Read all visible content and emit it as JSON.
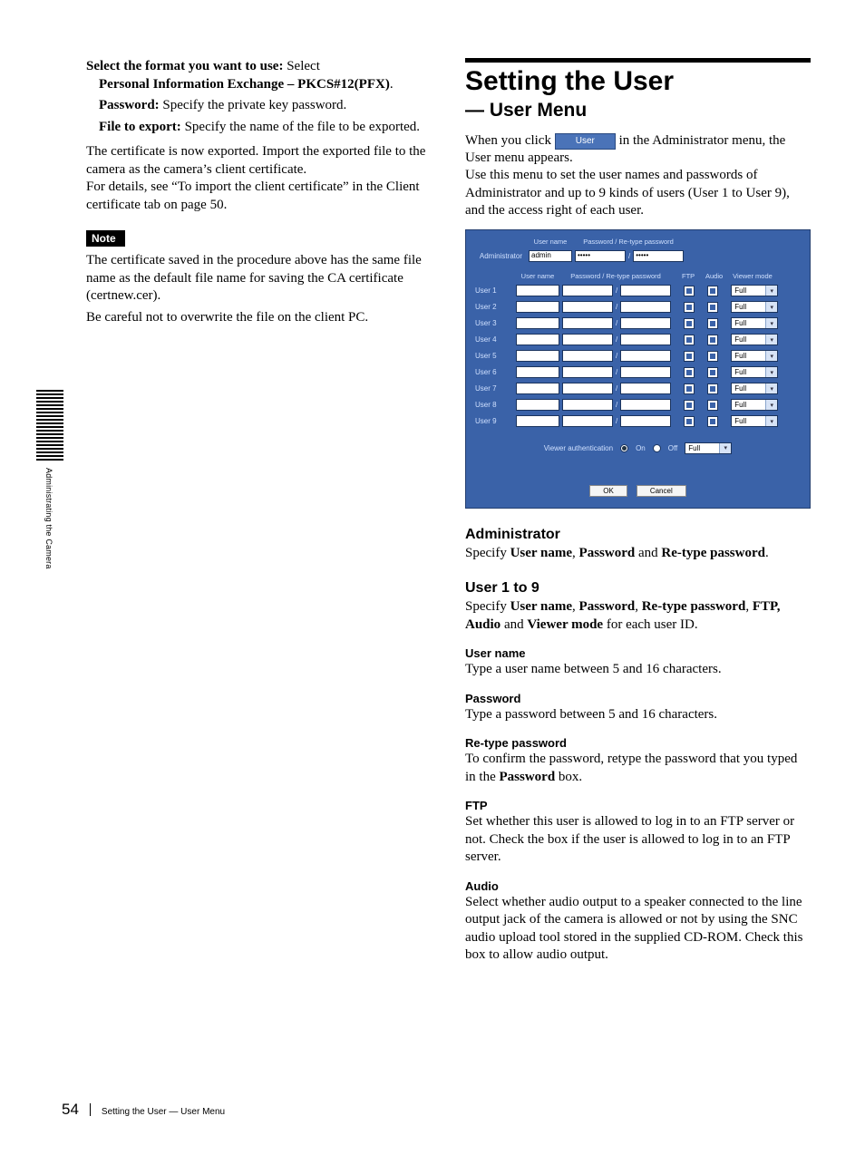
{
  "side_tab": {
    "text": "Administrating the Camera"
  },
  "left": {
    "l1a": "Select the format you want to use:",
    "l1b": " Select ",
    "l1c": "Personal Information Exchange – PKCS#12(PFX)",
    "l1d": ".",
    "l2a": "Password:",
    "l2b": " Specify the private key password.",
    "l3a": "File to export:",
    "l3b": " Specify the name of the file to be exported.",
    "p1": "The certificate is now exported. Import the exported file to the camera as the camera’s client certificate.",
    "p2": "For details, see “To import the client certificate” in the Client certificate tab on page 50.",
    "note_label": "Note",
    "note1": "The certificate saved in the procedure above has the same file name as the default file name for saving the CA certificate (certnew.cer).",
    "note2": "Be careful not to overwrite the file on the client PC."
  },
  "right": {
    "h1": "Setting the User",
    "h1_sub": "— User Menu",
    "intro_a": "When you click ",
    "btn_user": "User",
    "intro_b": " in the Administrator menu, the User menu appears.",
    "intro_c": "Use this menu to set the user names and passwords of Administrator and up to 9 kinds of users (User 1 to User 9), and the access right of each user.",
    "ui": {
      "hdr_username": "User name",
      "hdr_pw": "Password / Re-type password",
      "hdr_ftp": "FTP",
      "hdr_audio": "Audio",
      "hdr_vm": "Viewer mode",
      "admin_label": "Administrator",
      "admin_user": "admin",
      "admin_pw": "•••••",
      "admin_pw2": "•••••",
      "users": [
        {
          "label": "User 1",
          "mode": "Full"
        },
        {
          "label": "User 2",
          "mode": "Full"
        },
        {
          "label": "User 3",
          "mode": "Full"
        },
        {
          "label": "User 4",
          "mode": "Full"
        },
        {
          "label": "User 5",
          "mode": "Full"
        },
        {
          "label": "User 6",
          "mode": "Full"
        },
        {
          "label": "User 7",
          "mode": "Full"
        },
        {
          "label": "User 8",
          "mode": "Full"
        },
        {
          "label": "User 9",
          "mode": "Full"
        }
      ],
      "va_label": "Viewer authentication",
      "va_on": "On",
      "va_off": "Off",
      "va_mode": "Full",
      "ok": "OK",
      "cancel": "Cancel"
    },
    "h2_admin": "Administrator",
    "p_admin_a": "Specify ",
    "p_admin_b": "User name",
    "p_admin_c": ", ",
    "p_admin_d": "Password",
    "p_admin_e": " and ",
    "p_admin_f": "Re-type password",
    "p_admin_g": ".",
    "h2_users": "User 1 to 9",
    "p_users_a": "Specify ",
    "p_users_b": "User name",
    "p_users_c": ", ",
    "p_users_d": "Password",
    "p_users_e": ", ",
    "p_users_f": "Re-type password",
    "p_users_g": ", ",
    "p_users_h": "FTP, Audio",
    "p_users_i": " and ",
    "p_users_j": "Viewer mode",
    "p_users_k": " for each user ID.",
    "h3_un": "User name",
    "p_un": "Type a user name between 5 and 16 characters.",
    "h3_pw": "Password",
    "p_pw": "Type a password between 5 and 16 characters.",
    "h3_rpw": "Re-type password",
    "p_rpw_a": "To confirm the password, retype the password that you typed in the ",
    "p_rpw_b": "Password",
    "p_rpw_c": " box.",
    "h3_ftp": "FTP",
    "p_ftp": "Set whether this user is allowed to log in to an FTP server or not. Check the box if the user is allowed to log in to an FTP server.",
    "h3_audio": "Audio",
    "p_audio": "Select whether audio output to a speaker connected to the line output jack of the camera is allowed or not by using the SNC audio upload tool stored in the supplied CD-ROM. Check this box to allow audio output."
  },
  "footer": {
    "page": "54",
    "title": "Setting the User — User Menu"
  }
}
